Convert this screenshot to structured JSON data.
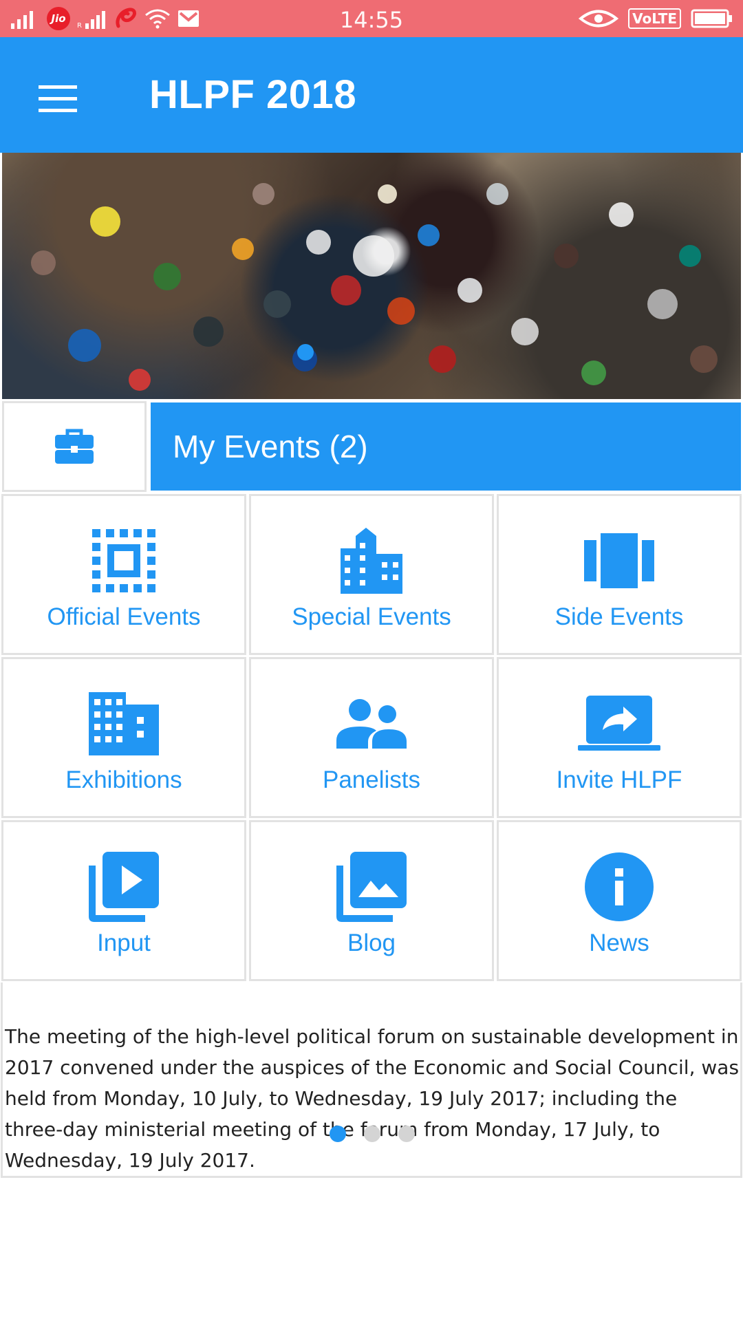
{
  "status_bar": {
    "carrier": "Jio",
    "time": "14:55",
    "network_badge": "VoLTE",
    "icons": [
      "signal-icon",
      "jio-icon",
      "roaming-signal-icon",
      "airtel-icon",
      "wifi-icon",
      "gmail-icon",
      "eye-icon",
      "volte-icon",
      "battery-icon"
    ]
  },
  "app_bar": {
    "title": "HLPF 2018",
    "color": "#2196f3"
  },
  "banner": {
    "carousel_index": 1
  },
  "my_events": {
    "label": "My Events (2)"
  },
  "tiles": [
    {
      "label": "Official Events",
      "icon": "official-events-icon"
    },
    {
      "label": "Special Events",
      "icon": "building-icon"
    },
    {
      "label": "Side Events",
      "icon": "carousel-icon"
    },
    {
      "label": "Exhibitions",
      "icon": "city-icon"
    },
    {
      "label": "Panelists",
      "icon": "people-icon"
    },
    {
      "label": "Invite HLPF",
      "icon": "laptop-share-icon"
    },
    {
      "label": "Input",
      "icon": "video-library-icon"
    },
    {
      "label": "Blog",
      "icon": "photo-library-icon"
    },
    {
      "label": "News",
      "icon": "info-icon"
    }
  ],
  "description": {
    "text": "The meeting of the high-level political forum on sustainable development in 2017 convened under the auspices of the Economic and Social Council, was held from Monday, 10 July, to Wednesday, 19 July 2017; including the three-day ministerial meeting of the forum from Monday, 17 July, to Wednesday, 19 July 2017.",
    "page_count": 3,
    "active_page": 1
  },
  "colors": {
    "status_bar": "#ef6c73",
    "accent": "#2196f3",
    "divider": "#e2e2e2"
  }
}
